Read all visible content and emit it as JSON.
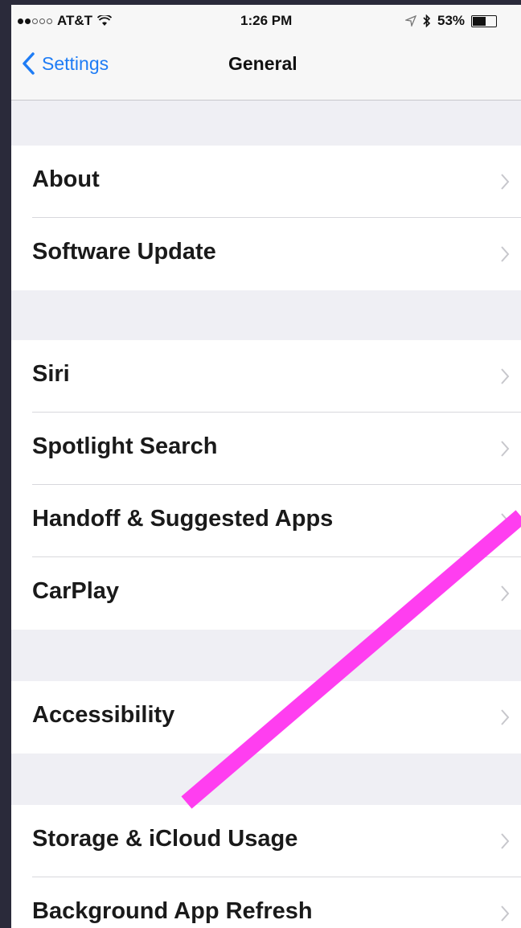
{
  "status_bar": {
    "carrier": "AT&T",
    "time": "1:26 PM",
    "battery_percent": "53%",
    "battery_level": 0.53,
    "icons": [
      "signal-dots-icon",
      "wifi-icon",
      "location-icon",
      "bluetooth-icon",
      "battery-icon"
    ]
  },
  "nav": {
    "back_label": "Settings",
    "title": "General"
  },
  "groups": [
    {
      "items": [
        {
          "label": "About"
        },
        {
          "label": "Software Update"
        }
      ]
    },
    {
      "items": [
        {
          "label": "Siri"
        },
        {
          "label": "Spotlight Search"
        },
        {
          "label": "Handoff & Suggested Apps"
        },
        {
          "label": "CarPlay"
        }
      ]
    },
    {
      "items": [
        {
          "label": "Accessibility"
        }
      ]
    },
    {
      "items": [
        {
          "label": "Storage & iCloud Usage"
        },
        {
          "label": "Background App Refresh"
        }
      ]
    }
  ],
  "colors": {
    "accent": "#1e7cf5",
    "annotation_arrow": "#ff3ef0",
    "grouped_background": "#efeff4"
  }
}
